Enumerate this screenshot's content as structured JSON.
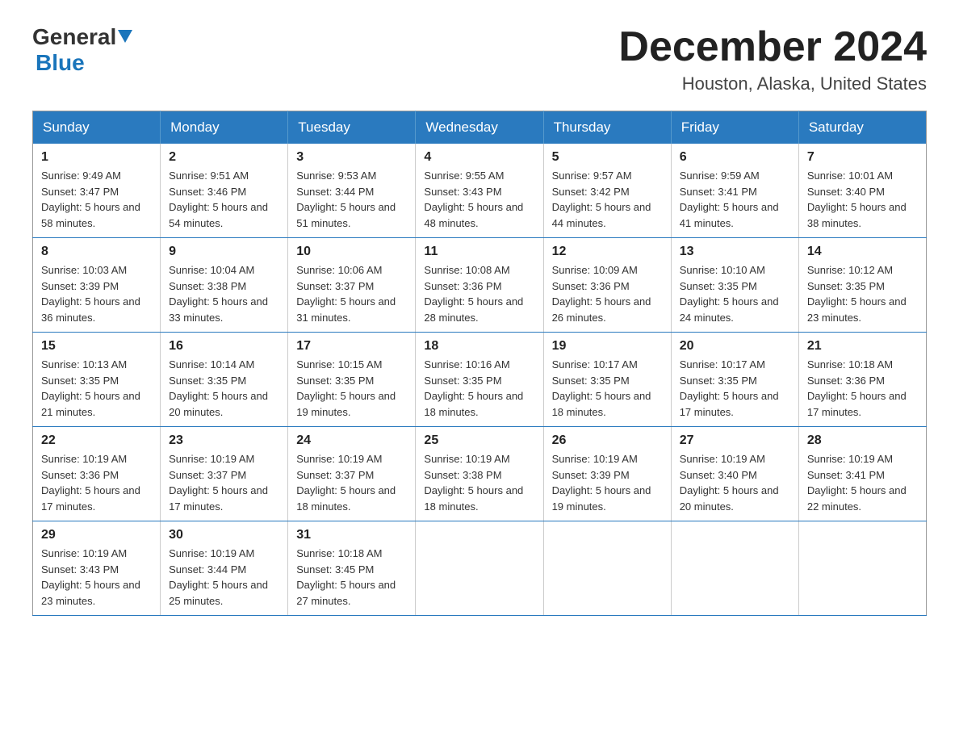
{
  "logo": {
    "general": "General",
    "blue": "Blue"
  },
  "title": "December 2024",
  "location": "Houston, Alaska, United States",
  "days_of_week": [
    "Sunday",
    "Monday",
    "Tuesday",
    "Wednesday",
    "Thursday",
    "Friday",
    "Saturday"
  ],
  "weeks": [
    [
      {
        "day": "1",
        "sunrise": "9:49 AM",
        "sunset": "3:47 PM",
        "daylight": "5 hours and 58 minutes."
      },
      {
        "day": "2",
        "sunrise": "9:51 AM",
        "sunset": "3:46 PM",
        "daylight": "5 hours and 54 minutes."
      },
      {
        "day": "3",
        "sunrise": "9:53 AM",
        "sunset": "3:44 PM",
        "daylight": "5 hours and 51 minutes."
      },
      {
        "day": "4",
        "sunrise": "9:55 AM",
        "sunset": "3:43 PM",
        "daylight": "5 hours and 48 minutes."
      },
      {
        "day": "5",
        "sunrise": "9:57 AM",
        "sunset": "3:42 PM",
        "daylight": "5 hours and 44 minutes."
      },
      {
        "day": "6",
        "sunrise": "9:59 AM",
        "sunset": "3:41 PM",
        "daylight": "5 hours and 41 minutes."
      },
      {
        "day": "7",
        "sunrise": "10:01 AM",
        "sunset": "3:40 PM",
        "daylight": "5 hours and 38 minutes."
      }
    ],
    [
      {
        "day": "8",
        "sunrise": "10:03 AM",
        "sunset": "3:39 PM",
        "daylight": "5 hours and 36 minutes."
      },
      {
        "day": "9",
        "sunrise": "10:04 AM",
        "sunset": "3:38 PM",
        "daylight": "5 hours and 33 minutes."
      },
      {
        "day": "10",
        "sunrise": "10:06 AM",
        "sunset": "3:37 PM",
        "daylight": "5 hours and 31 minutes."
      },
      {
        "day": "11",
        "sunrise": "10:08 AM",
        "sunset": "3:36 PM",
        "daylight": "5 hours and 28 minutes."
      },
      {
        "day": "12",
        "sunrise": "10:09 AM",
        "sunset": "3:36 PM",
        "daylight": "5 hours and 26 minutes."
      },
      {
        "day": "13",
        "sunrise": "10:10 AM",
        "sunset": "3:35 PM",
        "daylight": "5 hours and 24 minutes."
      },
      {
        "day": "14",
        "sunrise": "10:12 AM",
        "sunset": "3:35 PM",
        "daylight": "5 hours and 23 minutes."
      }
    ],
    [
      {
        "day": "15",
        "sunrise": "10:13 AM",
        "sunset": "3:35 PM",
        "daylight": "5 hours and 21 minutes."
      },
      {
        "day": "16",
        "sunrise": "10:14 AM",
        "sunset": "3:35 PM",
        "daylight": "5 hours and 20 minutes."
      },
      {
        "day": "17",
        "sunrise": "10:15 AM",
        "sunset": "3:35 PM",
        "daylight": "5 hours and 19 minutes."
      },
      {
        "day": "18",
        "sunrise": "10:16 AM",
        "sunset": "3:35 PM",
        "daylight": "5 hours and 18 minutes."
      },
      {
        "day": "19",
        "sunrise": "10:17 AM",
        "sunset": "3:35 PM",
        "daylight": "5 hours and 18 minutes."
      },
      {
        "day": "20",
        "sunrise": "10:17 AM",
        "sunset": "3:35 PM",
        "daylight": "5 hours and 17 minutes."
      },
      {
        "day": "21",
        "sunrise": "10:18 AM",
        "sunset": "3:36 PM",
        "daylight": "5 hours and 17 minutes."
      }
    ],
    [
      {
        "day": "22",
        "sunrise": "10:19 AM",
        "sunset": "3:36 PM",
        "daylight": "5 hours and 17 minutes."
      },
      {
        "day": "23",
        "sunrise": "10:19 AM",
        "sunset": "3:37 PM",
        "daylight": "5 hours and 17 minutes."
      },
      {
        "day": "24",
        "sunrise": "10:19 AM",
        "sunset": "3:37 PM",
        "daylight": "5 hours and 18 minutes."
      },
      {
        "day": "25",
        "sunrise": "10:19 AM",
        "sunset": "3:38 PM",
        "daylight": "5 hours and 18 minutes."
      },
      {
        "day": "26",
        "sunrise": "10:19 AM",
        "sunset": "3:39 PM",
        "daylight": "5 hours and 19 minutes."
      },
      {
        "day": "27",
        "sunrise": "10:19 AM",
        "sunset": "3:40 PM",
        "daylight": "5 hours and 20 minutes."
      },
      {
        "day": "28",
        "sunrise": "10:19 AM",
        "sunset": "3:41 PM",
        "daylight": "5 hours and 22 minutes."
      }
    ],
    [
      {
        "day": "29",
        "sunrise": "10:19 AM",
        "sunset": "3:43 PM",
        "daylight": "5 hours and 23 minutes."
      },
      {
        "day": "30",
        "sunrise": "10:19 AM",
        "sunset": "3:44 PM",
        "daylight": "5 hours and 25 minutes."
      },
      {
        "day": "31",
        "sunrise": "10:18 AM",
        "sunset": "3:45 PM",
        "daylight": "5 hours and 27 minutes."
      },
      null,
      null,
      null,
      null
    ]
  ],
  "labels": {
    "sunrise_prefix": "Sunrise: ",
    "sunset_prefix": "Sunset: ",
    "daylight_prefix": "Daylight: "
  }
}
